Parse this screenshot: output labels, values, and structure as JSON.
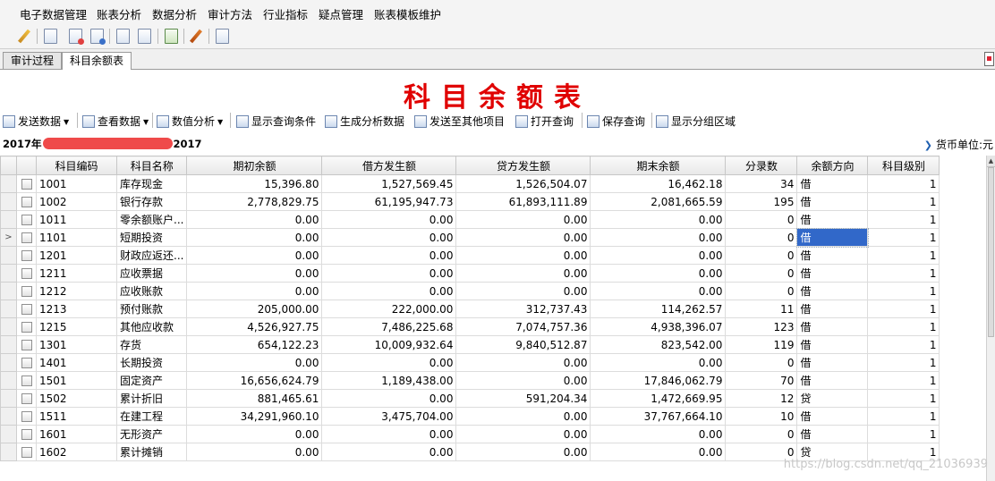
{
  "menu": [
    "电子数据管理",
    "账表分析",
    "数据分析",
    "审计方法",
    "行业指标",
    "疑点管理",
    "账表模板维护"
  ],
  "icons": [
    "edit-icon",
    "page-icon",
    "page-red-icon",
    "page-blue-icon",
    "copy-icon",
    "paste-icon",
    "chart-icon",
    "pencil-icon",
    "print-icon"
  ],
  "tabs": [
    "审计过程",
    "科目余额表"
  ],
  "report": {
    "title": "科目余额表"
  },
  "actions": [
    {
      "label": "发送数据",
      "has_menu": true,
      "icon": "send-icon"
    },
    {
      "label": "查看数据",
      "has_menu": true,
      "icon": "view-icon"
    },
    {
      "label": "数值分析",
      "has_menu": true,
      "icon": "analysis-icon"
    },
    {
      "label": "显示查询条件",
      "has_menu": false,
      "icon": "search-icon"
    },
    {
      "label": "生成分析数据",
      "has_menu": false,
      "icon": "generate-icon"
    },
    {
      "label": "发送至其他项目",
      "has_menu": false,
      "icon": "grid-icon"
    },
    {
      "label": "打开查询",
      "has_menu": false,
      "icon": "folder-icon"
    },
    {
      "label": "保存查询",
      "has_menu": false,
      "icon": "save-icon"
    },
    {
      "label": "显示分组区域",
      "has_menu": false,
      "icon": "group-icon"
    }
  ],
  "period": {
    "start": "2017年",
    "end": "2017"
  },
  "currency": "货币单位:元",
  "table": {
    "columns": [
      "科目编码",
      "科目名称",
      "期初余额",
      "借方发生额",
      "贷方发生额",
      "期末余额",
      "分录数",
      "余额方向",
      "科目级别"
    ],
    "rows": [
      [
        "1001",
        "库存现金",
        "15,396.80",
        "1,527,569.45",
        "1,526,504.07",
        "16,462.18",
        "34",
        "借",
        "1"
      ],
      [
        "1002",
        "银行存款",
        "2,778,829.75",
        "61,195,947.73",
        "61,893,111.89",
        "2,081,665.59",
        "195",
        "借",
        "1"
      ],
      [
        "1011",
        "零余额账户...",
        "0.00",
        "0.00",
        "0.00",
        "0.00",
        "0",
        "借",
        "1"
      ],
      [
        "1101",
        "短期投资",
        "0.00",
        "0.00",
        "0.00",
        "0.00",
        "0",
        "借",
        "1"
      ],
      [
        "1201",
        "财政应返还...",
        "0.00",
        "0.00",
        "0.00",
        "0.00",
        "0",
        "借",
        "1"
      ],
      [
        "1211",
        "应收票据",
        "0.00",
        "0.00",
        "0.00",
        "0.00",
        "0",
        "借",
        "1"
      ],
      [
        "1212",
        "应收账款",
        "0.00",
        "0.00",
        "0.00",
        "0.00",
        "0",
        "借",
        "1"
      ],
      [
        "1213",
        "预付账款",
        "205,000.00",
        "222,000.00",
        "312,737.43",
        "114,262.57",
        "11",
        "借",
        "1"
      ],
      [
        "1215",
        "其他应收款",
        "4,526,927.75",
        "7,486,225.68",
        "7,074,757.36",
        "4,938,396.07",
        "123",
        "借",
        "1"
      ],
      [
        "1301",
        "存货",
        "654,122.23",
        "10,009,932.64",
        "9,840,512.87",
        "823,542.00",
        "119",
        "借",
        "1"
      ],
      [
        "1401",
        "长期投资",
        "0.00",
        "0.00",
        "0.00",
        "0.00",
        "0",
        "借",
        "1"
      ],
      [
        "1501",
        "固定资产",
        "16,656,624.79",
        "1,189,438.00",
        "0.00",
        "17,846,062.79",
        "70",
        "借",
        "1"
      ],
      [
        "1502",
        "累计折旧",
        "881,465.61",
        "0.00",
        "591,204.34",
        "1,472,669.95",
        "12",
        "贷",
        "1"
      ],
      [
        "1511",
        "在建工程",
        "34,291,960.10",
        "3,475,704.00",
        "0.00",
        "37,767,664.10",
        "10",
        "借",
        "1"
      ],
      [
        "1601",
        "无形资产",
        "0.00",
        "0.00",
        "0.00",
        "0.00",
        "0",
        "借",
        "1"
      ],
      [
        "1602",
        "累计摊销",
        "0.00",
        "0.00",
        "0.00",
        "0.00",
        "0",
        "贷",
        "1"
      ]
    ],
    "current_row_marker": ">",
    "selected_row": 3
  },
  "watermark": "https://blog.csdn.net/qq_21036939",
  "colors": {
    "title": "#e00000",
    "selection": "#3168c9"
  }
}
